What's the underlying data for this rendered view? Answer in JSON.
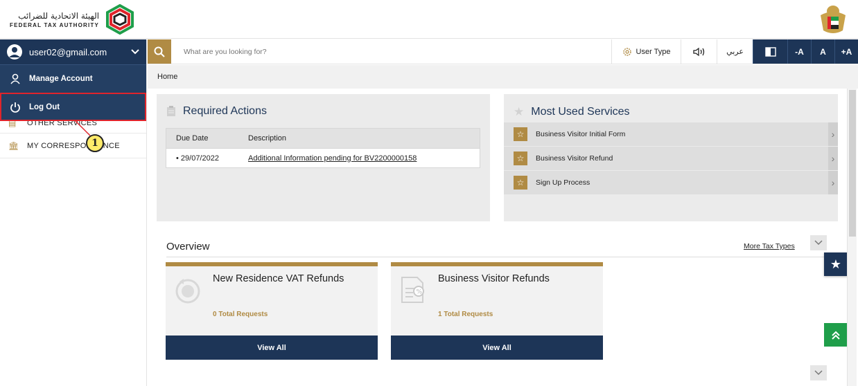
{
  "header": {
    "logo_ar": "الهيئة الاتحادية للضرائب",
    "logo_en": "FEDERAL TAX AUTHORITY"
  },
  "sidebar": {
    "user_email": "user02@gmail.com",
    "dropdown": [
      {
        "label": "Manage Account",
        "icon": "person-icon"
      },
      {
        "label": "Log Out",
        "icon": "power-icon"
      }
    ],
    "links": [
      {
        "label": "OTHER SERVICES",
        "icon": "document-icon"
      },
      {
        "label": "MY CORRESPONDENCE",
        "icon": "bank-icon"
      }
    ],
    "step_marker": "1"
  },
  "search": {
    "placeholder": "What are you looking for?"
  },
  "toolbar": {
    "user_type": "User Type",
    "language": "عربي",
    "font_decrease": "-A",
    "font_normal": "A",
    "font_increase": "+A"
  },
  "breadcrumb": "Home",
  "required_actions": {
    "title": "Required Actions",
    "headers": [
      "Due Date",
      "Description"
    ],
    "rows": [
      {
        "date": "• 29/07/2022",
        "description": "Additional Information pending for BV2200000158"
      }
    ]
  },
  "most_used": {
    "title": "Most Used Services",
    "items": [
      "Business Visitor Initial Form",
      "Business Visitor Refund",
      "Sign Up Process"
    ]
  },
  "overview": {
    "title": "Overview",
    "more_link": "More Tax Types",
    "cards": [
      {
        "title": "New Residence VAT Refunds",
        "count": "0 Total Requests",
        "button": "View All"
      },
      {
        "title": "Business Visitor Refunds",
        "count": "1 Total Requests",
        "button": "View All"
      }
    ]
  },
  "colors": {
    "navy": "#1d3557",
    "gold": "#b08b44",
    "green": "#1f9e4a",
    "highlight_red": "#e0242b"
  }
}
